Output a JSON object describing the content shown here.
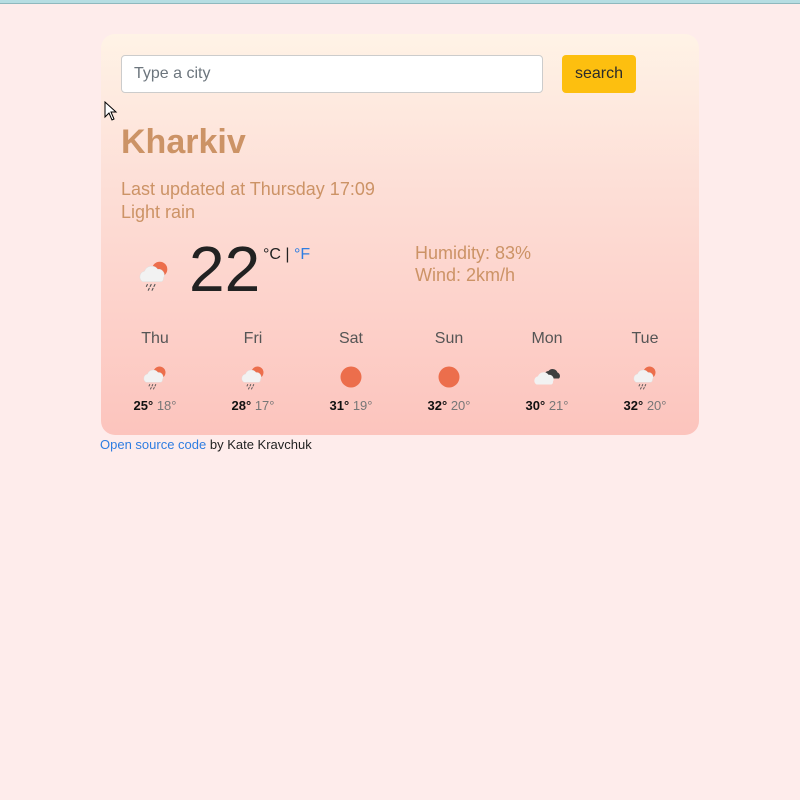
{
  "search": {
    "placeholder": "Type a city",
    "value": "",
    "button_label": "search"
  },
  "city": "Kharkiv",
  "last_updated": "Last updated at Thursday 17:09",
  "description": "Light rain",
  "current": {
    "icon": "rain-sun-icon",
    "temperature": "22",
    "unit_celsius": "°C",
    "unit_separator": " | ",
    "unit_fahrenheit": "°F",
    "humidity": "Humidity: 83%",
    "wind": "Wind: 2km/h"
  },
  "forecast": [
    {
      "day": "Thu",
      "icon": "rain-sun-icon",
      "max": "25°",
      "min": "18°"
    },
    {
      "day": "Fri",
      "icon": "rain-sun-icon",
      "max": "28°",
      "min": "17°"
    },
    {
      "day": "Sat",
      "icon": "sun-icon",
      "max": "31°",
      "min": "19°"
    },
    {
      "day": "Sun",
      "icon": "sun-icon",
      "max": "32°",
      "min": "20°"
    },
    {
      "day": "Mon",
      "icon": "broken-clouds-icon",
      "max": "30°",
      "min": "21°"
    },
    {
      "day": "Tue",
      "icon": "rain-sun-icon",
      "max": "32°",
      "min": "20°"
    }
  ],
  "footer": {
    "link_text": "Open source code",
    "by_text": " by Kate Kravchuk"
  },
  "colors": {
    "accent": "#cc9366",
    "button": "#fdbf0f",
    "link": "#2f7de1",
    "sun": "#ec6e4c"
  }
}
